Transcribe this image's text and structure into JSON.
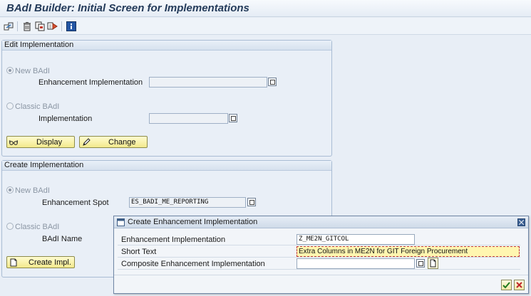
{
  "window": {
    "title": "BAdI Builder: Initial Screen for Implementations"
  },
  "toolbar": {
    "buttons": [
      {
        "icon": "other-object-icon"
      },
      {
        "icon": "delete-icon"
      },
      {
        "icon": "copy-icon"
      },
      {
        "icon": "rename-icon"
      },
      {
        "icon": "information-icon"
      }
    ]
  },
  "edit_group": {
    "title": "Edit Implementation",
    "new_badi": {
      "radio_label": "New BAdI",
      "field_label": "Enhancement Implementation",
      "value": ""
    },
    "classic_badi": {
      "radio_label": "Classic BAdI",
      "field_label": "Implementation",
      "value": ""
    },
    "display_label": "Display",
    "change_label": "Change"
  },
  "create_group": {
    "title": "Create Implementation",
    "new_badi": {
      "radio_label": "New BAdI",
      "field_label": "Enhancement Spot",
      "value": "ES_BADI_ME_REPORTING"
    },
    "classic_badi": {
      "radio_label": "Classic BAdI",
      "field_label": "BAdI Name",
      "value": ""
    },
    "create_label": "Create Impl."
  },
  "dialog": {
    "title": "Create Enhancement Implementation",
    "rows": [
      {
        "label": "Enhancement Implementation",
        "value": "Z_ME2N_GITCOL"
      },
      {
        "label": "Short Text",
        "value": "Extra Columns in ME2N for GIT Foreign Procurement"
      },
      {
        "label": "Composite Enhancement Implementation",
        "value": ""
      }
    ]
  },
  "colors": {
    "button_yellow": "#f3e98d",
    "field_highlight": "#fff6b0",
    "group_border": "#a9bcd4",
    "title_text": "#243b5a"
  }
}
